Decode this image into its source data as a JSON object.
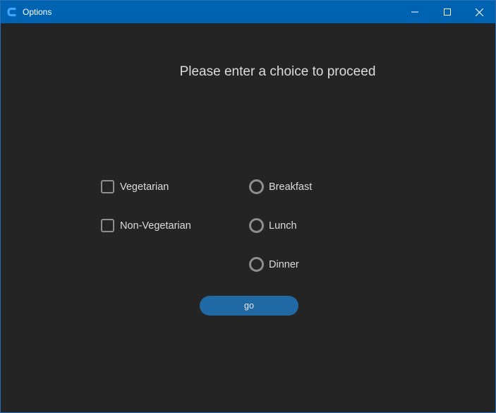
{
  "window": {
    "title": "Options",
    "accent_color": "#0063b1",
    "background_color": "#242424",
    "icons": [
      "app-logo-icon",
      "minimize-icon",
      "maximize-icon",
      "close-icon"
    ]
  },
  "main": {
    "prompt": "Please enter a choice to proceed",
    "checkboxes": [
      {
        "label": "Vegetarian",
        "checked": false
      },
      {
        "label": "Non-Vegetarian",
        "checked": false
      }
    ],
    "radios": [
      {
        "label": "Breakfast",
        "selected": false
      },
      {
        "label": "Lunch",
        "selected": false
      },
      {
        "label": "Dinner",
        "selected": false
      }
    ],
    "button": {
      "label": "go",
      "color": "#1f6aa5"
    }
  }
}
